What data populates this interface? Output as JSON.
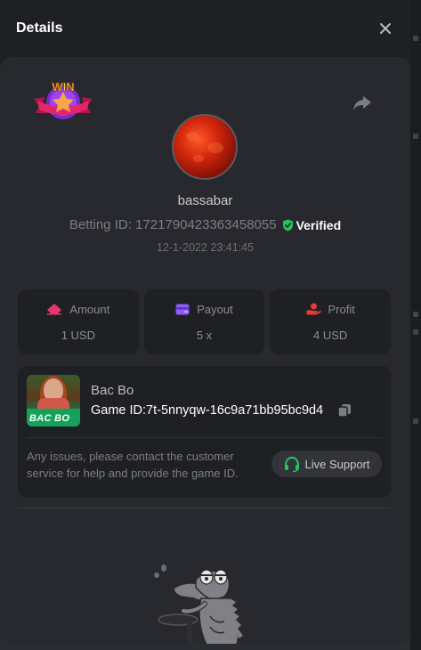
{
  "modal": {
    "title": "Details"
  },
  "bet": {
    "username": "bassabar",
    "betting_id_label": "Betting ID:",
    "betting_id": "1721790423363458055",
    "verified_label": "Verified",
    "timestamp": "12-1-2022 23:41:45",
    "badge_text": "WIN"
  },
  "stats": [
    {
      "label": "Amount",
      "value": "1 USD",
      "icon": "amount-icon",
      "color": "#e8356b"
    },
    {
      "label": "Payout",
      "value": "5 x",
      "icon": "wallet-icon",
      "color": "#8b5cf6"
    },
    {
      "label": "Profit",
      "value": "4 USD",
      "icon": "profit-icon",
      "color": "#e5393b"
    }
  ],
  "game": {
    "thumb_logo": "BAC BO",
    "name": "Bac Bo",
    "id_label": "Game ID:",
    "id_value": "7t-5nnyqw-16c9a71bb95bc9d4",
    "issue_text": "Any issues, please contact the customer service for help and provide the game ID.",
    "support_label": "Live Support"
  },
  "colors": {
    "verified": "#22c55e",
    "support_icon": "#22c55e",
    "modal_bg": "#1f2024",
    "panel_bg": "#28292e"
  }
}
